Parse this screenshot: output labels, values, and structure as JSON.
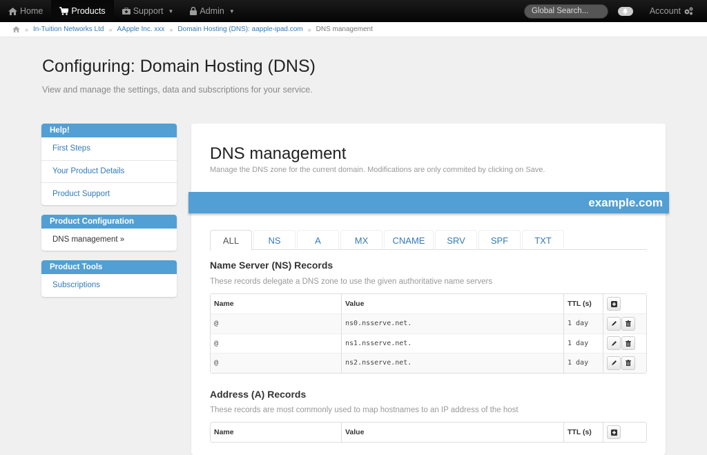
{
  "nav": {
    "items": [
      {
        "label": "Home",
        "icon": "home-icon"
      },
      {
        "label": "Products",
        "icon": "cart-icon",
        "active": true
      },
      {
        "label": "Support",
        "icon": "support-icon",
        "dropdown": true
      },
      {
        "label": "Admin",
        "icon": "lock-icon",
        "dropdown": true
      }
    ],
    "search_placeholder": "Global Search...",
    "account_label": "Account"
  },
  "breadcrumb": {
    "items": [
      "In-Tuition Networks Ltd",
      "AApple Inc. xxx",
      "Domain Hosting (DNS): aapple-ipad.com"
    ],
    "current": "DNS management"
  },
  "header": {
    "title": "Configuring: Domain Hosting (DNS)",
    "subtitle": "View and manage the settings, data and subscriptions for your service."
  },
  "sidebar": {
    "panels": [
      {
        "heading": "Help!",
        "items": [
          "First Steps",
          "Your Product Details",
          "Product Support"
        ]
      },
      {
        "heading": "Product Configuration",
        "items": [
          "DNS management »"
        ]
      },
      {
        "heading": "Product Tools",
        "items": [
          "Subscriptions"
        ]
      }
    ]
  },
  "main": {
    "title": "DNS management",
    "subtitle": "Manage the DNS zone for the current domain. Modifications are only commited by clicking on Save.",
    "domain": "example.com",
    "tabs": [
      "ALL",
      "NS",
      "A",
      "MX",
      "CNAME",
      "SRV",
      "SPF",
      "TXT"
    ],
    "active_tab": "ALL",
    "columns": {
      "name": "Name",
      "value": "Value",
      "ttl": "TTL (s)"
    },
    "ns_section": {
      "title": "Name Server (NS) Records",
      "desc": "These records delegate a DNS zone to use the given authoritative name servers",
      "rows": [
        {
          "name": "@",
          "value": "ns0.nsserve.net.",
          "ttl": "1 day"
        },
        {
          "name": "@",
          "value": "ns1.nsserve.net.",
          "ttl": "1 day"
        },
        {
          "name": "@",
          "value": "ns2.nsserve.net.",
          "ttl": "1 day"
        }
      ]
    },
    "a_section": {
      "title": "Address (A) Records",
      "desc": "These records are most commonly used to map hostnames to an IP address of the host",
      "rows": []
    }
  }
}
